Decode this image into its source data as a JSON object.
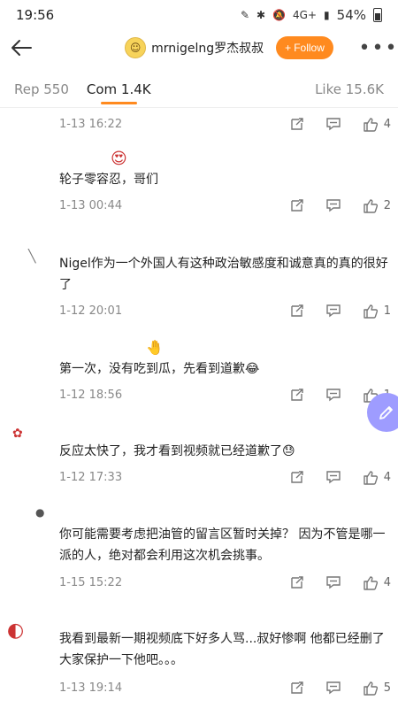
{
  "status_bar": {
    "time": "19:56",
    "network": "4G+",
    "battery": "54%"
  },
  "header": {
    "username": "mrnigelng罗杰叔叔",
    "follow_label": "Follow"
  },
  "tabs": [
    {
      "label": "Rep 550"
    },
    {
      "label": "Com 1.4K"
    },
    {
      "label": "Like 15.6K"
    }
  ],
  "comments": [
    {
      "text": "",
      "date": "1-13 16:22",
      "likes": "4"
    },
    {
      "text": "轮子零容忍，哥们",
      "date": "1-13 00:44",
      "likes": "2"
    },
    {
      "text": "Nigel作为一个外国人有这种政治敏感度和诚意真的真的很好了",
      "date": "1-12 20:01",
      "likes": "1"
    },
    {
      "text": "第一次，没有吃到瓜，先看到道歉😂",
      "date": "1-12 18:56",
      "likes": "1"
    },
    {
      "text": "反应太快了，我才看到视频就已经道歉了😓",
      "date": "1-12 17:33",
      "likes": "4"
    },
    {
      "text": "你可能需要考虑把油管的留言区暂时关掉？ 因为不管是哪一派的人，绝对都会利用这次机会挑事。",
      "date": "1-15 15:22",
      "likes": "4"
    },
    {
      "text": "我看到最新一期视频底下好多人骂...叔好惨啊 他都已经删了 大家保护一下他吧。。。",
      "date": "1-13 19:14",
      "likes": "5"
    }
  ],
  "icons": {
    "back": "arrow-left-icon",
    "repost": "repost-icon",
    "comment": "comment-icon",
    "like": "thumbs-up-icon",
    "more": "more-icon",
    "compose": "pencil-icon"
  },
  "colors": {
    "accent": "#ff8a1f",
    "fab": "#9e9cff"
  }
}
